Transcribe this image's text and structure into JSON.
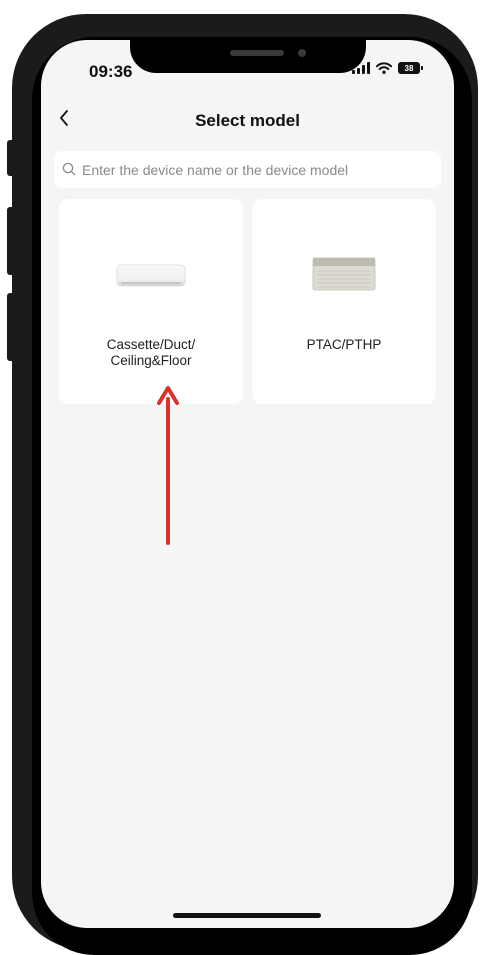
{
  "status_bar": {
    "time": "09:36",
    "battery": "38"
  },
  "header": {
    "title": "Select model"
  },
  "search": {
    "placeholder": "Enter the device name or the device model",
    "value": ""
  },
  "models": [
    {
      "label": "Cassette/Duct/\nCeiling&Floor",
      "icon": "wall-unit-ac-icon"
    },
    {
      "label": "PTAC/PTHP",
      "icon": "ptac-unit-icon"
    }
  ],
  "colors": {
    "annotation_arrow": "#d9322b",
    "background": "#f5f5f5",
    "card": "#ffffff"
  }
}
